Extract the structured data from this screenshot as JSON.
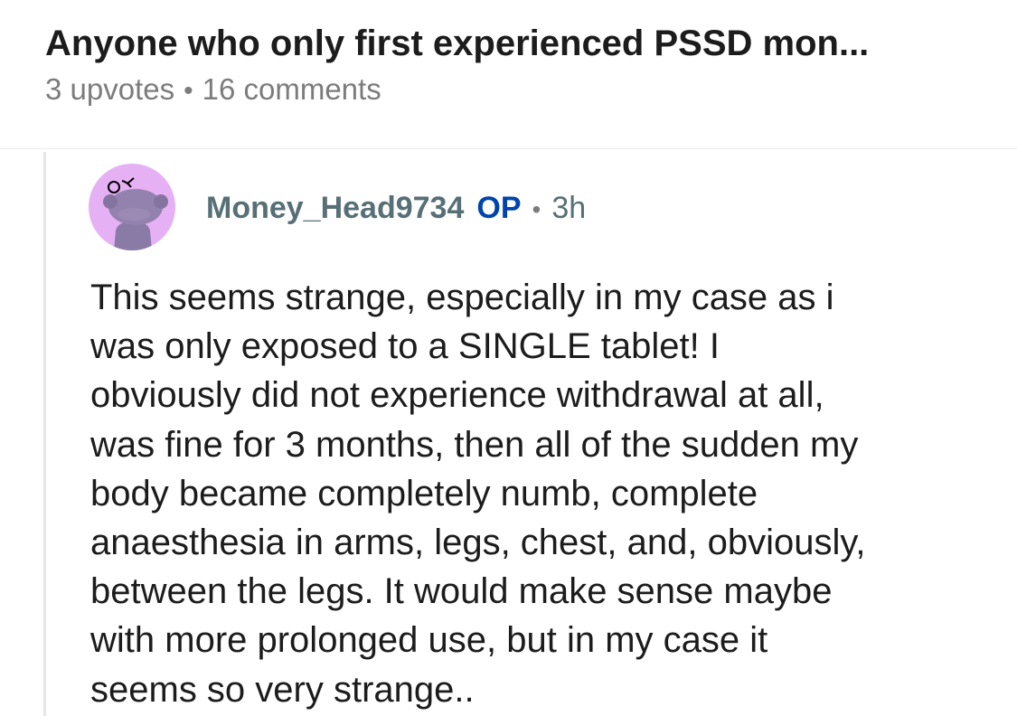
{
  "post": {
    "title": "Anyone who only first experienced PSSD mon...",
    "upvotes": "3 upvotes",
    "separator": "•",
    "comments": "16 comments"
  },
  "comment": {
    "avatar_icon": "snoo-avatar-icon",
    "avatar_color": "#e6b0f4",
    "author": "Money_Head9734",
    "badge": "OP",
    "separator": "•",
    "time": "3h",
    "lines": [
      "This seems strange, especially in my case as i",
      "was only exposed to a SINGLE tablet! I",
      "obviously did not experience withdrawal at all,",
      "was fine for 3 months, then all of the sudden my",
      "body became completely numb, complete",
      "anaesthesia in arms, legs, chest, and, obviously,",
      "between the legs. It would make sense maybe",
      "with more prolonged use, but in my case it",
      "seems so very strange.."
    ]
  }
}
